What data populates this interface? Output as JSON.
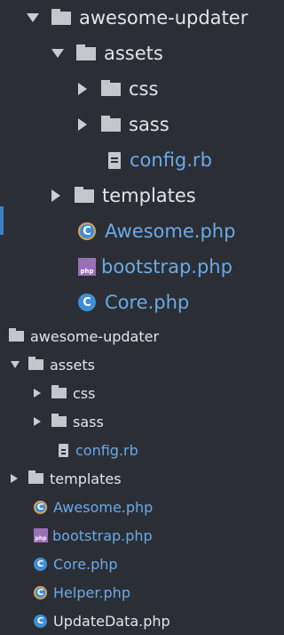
{
  "top_tree": {
    "rows": [
      {
        "label": "awesome-updater"
      },
      {
        "label": "assets"
      },
      {
        "label": "css"
      },
      {
        "label": "sass"
      },
      {
        "label": "config.rb"
      },
      {
        "label": "templates"
      },
      {
        "label": "Awesome.php"
      },
      {
        "label": "bootstrap.php"
      },
      {
        "label": "Core.php"
      }
    ]
  },
  "bottom_tree": {
    "rows": [
      {
        "label": "awesome-updater"
      },
      {
        "label": "assets"
      },
      {
        "label": "css"
      },
      {
        "label": "sass"
      },
      {
        "label": "config.rb"
      },
      {
        "label": "templates"
      },
      {
        "label": "Awesome.php"
      },
      {
        "label": "bootstrap.php"
      },
      {
        "label": "Core.php"
      },
      {
        "label": "Helper.php"
      },
      {
        "label": "UpdateData.php"
      }
    ]
  },
  "icons": {
    "class_badge": "C",
    "php_badge": "php"
  },
  "colors": {
    "background": "#2b2f35",
    "folder": "#c3c6cb",
    "file_text_blue": "#6aa9e8",
    "class_icon": "#3f8fd6",
    "php_icon": "#9b6fb8",
    "selection_marker": "#3b82c4"
  }
}
